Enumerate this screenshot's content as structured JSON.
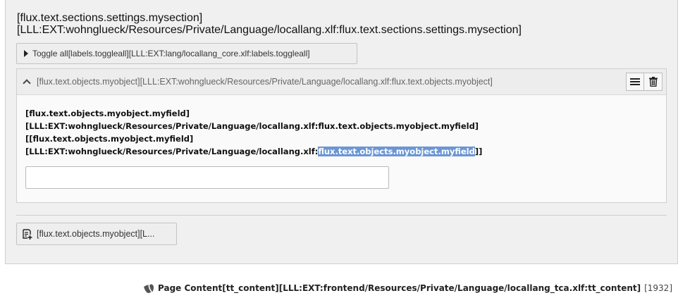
{
  "section": {
    "title_line1": "[flux.text.sections.settings.mysection]",
    "title_line2": "[LLL:EXT:wohnglueck/Resources/Private/Language/locallang.xlf:flux.text.sections.settings.mysection]"
  },
  "toggle_all": {
    "label": "Toggle all[labels.toggleall][LLL:EXT:lang/locallang_core.xlf:labels.toggleall]",
    "icon": "caret-right-icon"
  },
  "object": {
    "title": "[flux.text.objects.myobject][LLL:EXT:wohnglueck/Resources/Private/Language/locallang.xlf:flux.text.objects.myobject]",
    "chevron_icon": "chevron-up-icon",
    "actions": [
      {
        "name": "drag-handle",
        "icon": "hamburger-icon"
      },
      {
        "name": "delete",
        "icon": "trash-icon"
      }
    ],
    "field": {
      "label_line1": "[flux.text.objects.myobject.myfield]",
      "label_line2": "[LLL:EXT:wohnglueck/Resources/Private/Language/locallang.xlf:flux.text.objects.myobject.myfield]",
      "label_line3": "[[flux.text.objects.myobject.myfield]",
      "label_line4_prefix": "[LLL:EXT:wohnglueck/Resources/Private/Language/locallang.xlf:",
      "label_line4_selected": "flux.text.objects.myobject.myfield",
      "label_line4_suffix": "]]",
      "value": "",
      "placeholder": ""
    }
  },
  "add_button": {
    "label": "[flux.text.objects.myobject][L...",
    "icon": "add-content-icon"
  },
  "footer": {
    "icon": "typo3-logo-icon",
    "label": "Page Content[tt_content][LLL:EXT:frontend/Resources/Private/Language/locallang_tca.xlf:tt_content]",
    "uid": "[1932]"
  },
  "colors": {
    "selection": "#6b96d4",
    "panel_bg": "#f0f0f0",
    "header_bg": "#ededed"
  }
}
